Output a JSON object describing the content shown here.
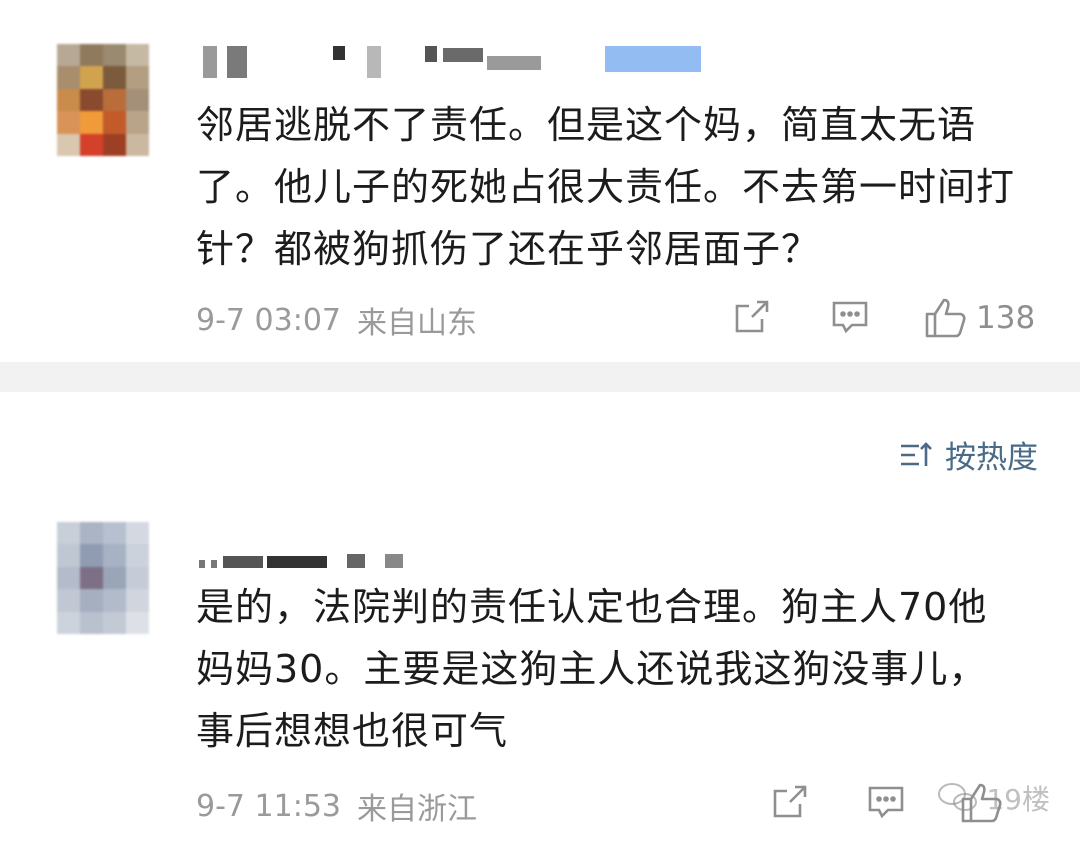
{
  "comments": [
    {
      "text": "邻居逃脱不了责任。但是这个妈，简直太无语了。他儿子的死她占很大责任。不去第一时间打针？都被狗抓伤了还在乎邻居面子？",
      "time": "9-7 03:07",
      "location": "来自山东",
      "likes": "138"
    },
    {
      "text": "是的，法院判的责任认定也合理。狗主人70他妈妈30。主要是这狗主人还说我这狗没事儿，事后想想也很可气",
      "time": "9-7 11:53",
      "location": "来自浙江",
      "likes": ""
    }
  ],
  "sort": {
    "label": "按热度"
  },
  "watermark": {
    "text": "19楼"
  },
  "icons": {
    "share": "share-icon",
    "comment": "comment-icon",
    "like": "like-icon",
    "sort": "sort-icon"
  },
  "colors": {
    "text": "#1c1c1c",
    "meta": "#9a9a9a",
    "sort_accent": "#4a6a86",
    "divider": "#f2f2f2"
  }
}
